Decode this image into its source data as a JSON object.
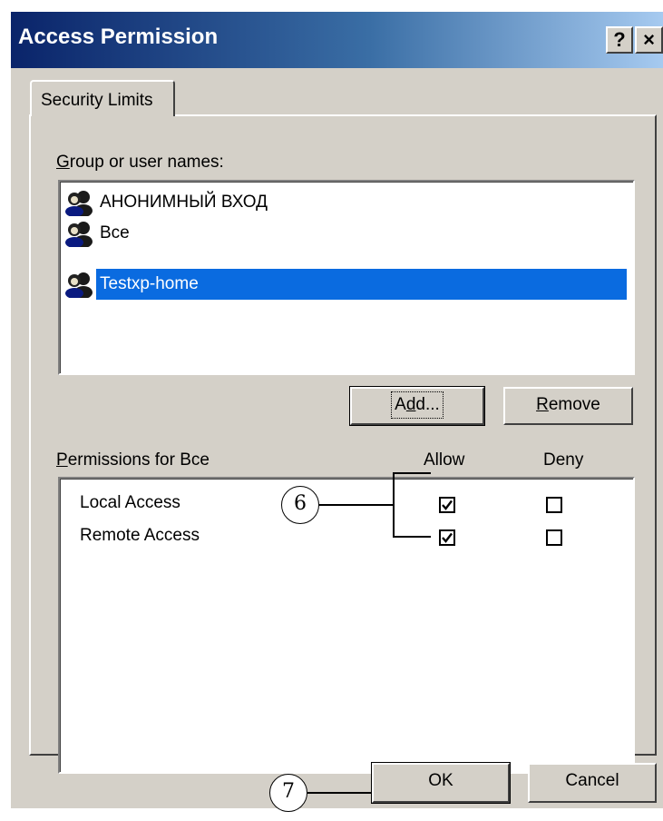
{
  "window": {
    "title": "Access Permission",
    "help_label": "?",
    "close_label": "×"
  },
  "tabs": [
    {
      "label": "Security Limits"
    }
  ],
  "users_section": {
    "label_accel": "G",
    "label_rest": "roup or user names:",
    "items": [
      {
        "name": "АНОНИМНЫЙ ВХОД",
        "selected": false
      },
      {
        "name": "Все",
        "selected": false
      },
      {
        "name": "Testxp-home",
        "selected": true
      }
    ],
    "add_accel": "d",
    "add_pre": "A",
    "add_post": "d...",
    "remove_accel": "R",
    "remove_rest": "emove"
  },
  "permissions": {
    "label_accel": "P",
    "label_rest": "ermissions for Все",
    "allow_header": "Allow",
    "deny_header": "Deny",
    "rows": [
      {
        "name": "Local Access",
        "allow": true,
        "deny": false
      },
      {
        "name": "Remote Access",
        "allow": true,
        "deny": false
      }
    ]
  },
  "callouts": {
    "six": "6",
    "seven": "7"
  },
  "footer": {
    "ok_label": "OK",
    "cancel_label": "Cancel"
  },
  "colors": {
    "titlebar_start": "#0a246a",
    "titlebar_end": "#a6caf0",
    "selection": "#0a6be0",
    "face": "#d4d0c8"
  }
}
